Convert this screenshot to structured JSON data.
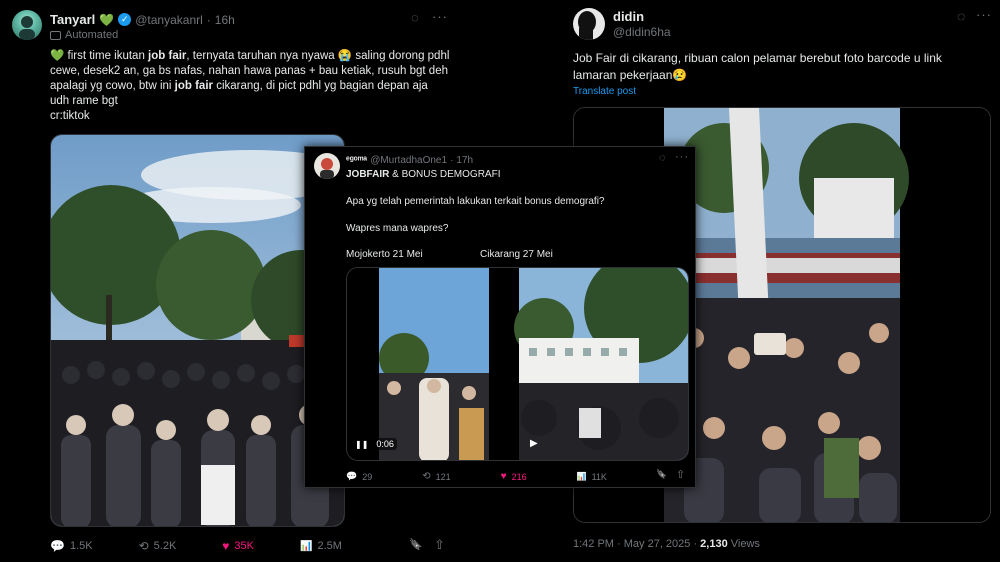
{
  "left": {
    "name": "Tanyarl",
    "emoji": "💚",
    "handle": "@tanyakanrl",
    "sep": "·",
    "time": "16h",
    "automated": "Automated",
    "text": {
      "p1": "💚 first time ikutan ",
      "b1": "job fair",
      "p2": ", ternyata taruhan nya nyawa 😭 saling dorong pdhl cewe, desek2 an, ga bs nafas, nahan hawa panas + bau ketiak, rusuh bgt deh apalagi yg cowo, btw ini ",
      "b2": "job fair",
      "p3": " cikarang, di pict pdhl yg bagian depan aja udh rame bgt",
      "p4": "cr:tiktok"
    },
    "stats": {
      "replies": "1.5K",
      "retweets": "5.2K",
      "likes": "35K",
      "views": "2.5M"
    }
  },
  "middle": {
    "name": "ᵉᵍᵒᵐᵃ",
    "handle": "@MurtadhaOne1",
    "sep": "·",
    "time": "17h",
    "title_b": "JOBFAIR",
    "title_rest": " & BONUS DEMOGRAFI",
    "q1": "Apa yg telah pemerintah lakukan terkait bonus demografi?",
    "q2": "Wapres mana wapres?",
    "label_left": "Mojokerto 21 Mei",
    "label_right": "Cikarang 27 Mei",
    "video_time": "0:06",
    "stats": {
      "replies": "29",
      "retweets": "121",
      "likes": "216",
      "views": "11K"
    }
  },
  "right": {
    "name": "didin",
    "handle": "@didin6ha",
    "text": "Job Fair di cikarang, ribuan calon pelamar berebut foto barcode u link lamaran pekerjaan😢",
    "translate": "Translate post",
    "time": "1:42 PM · May 27, 2025 · ",
    "views_count": "2,130",
    "views_label": " Views"
  },
  "icons": {
    "grok": "◌",
    "more": "···",
    "reply": "💬",
    "retweet": "⟲",
    "like": "♥",
    "views": "📊",
    "bookmark": "🔖",
    "share": "⇧"
  }
}
